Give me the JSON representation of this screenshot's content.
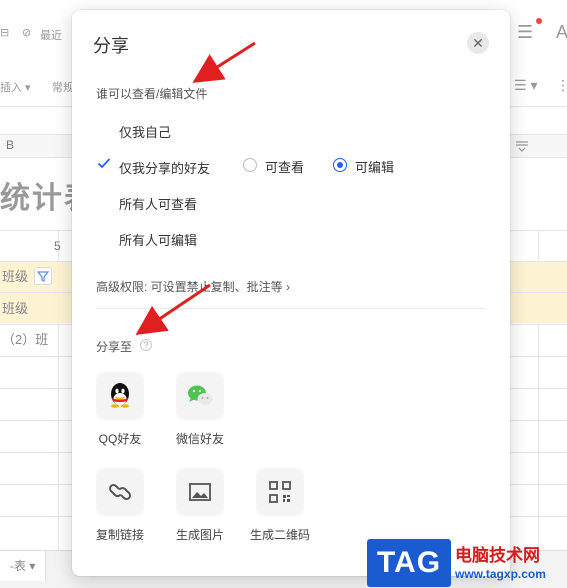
{
  "background": {
    "toolbar": {
      "recent_label": "最近",
      "insert_label": "插入",
      "normal_label": "常规",
      "top_right_letter": "A"
    },
    "column_header_label": "B",
    "sheet_title": "统计表",
    "column_number": "5",
    "cells": [
      "班级",
      "班级",
      "（2）班"
    ],
    "sheet_tab": "-表"
  },
  "dialog": {
    "title": "分享",
    "who_label": "谁可以查看/编辑文件",
    "options": [
      "仅我自己",
      "仅我分享的好友",
      "所有人可查看",
      "所有人可编辑"
    ],
    "radios": [
      "可查看",
      "可编辑"
    ],
    "selected_radio": "可编辑",
    "advanced": "高级权限: 可设置禁止复制、批注等",
    "share_to_label": "分享至",
    "targets": [
      {
        "label": "QQ好友",
        "icon": "qq-icon"
      },
      {
        "label": "微信好友",
        "icon": "wechat-icon"
      },
      {
        "label": "复制链接",
        "icon": "link-icon"
      },
      {
        "label": "生成图片",
        "icon": "image-icon"
      },
      {
        "label": "生成二维码",
        "icon": "qrcode-icon"
      }
    ]
  },
  "watermark": {
    "tag": "TAG",
    "name": "电脑技术网",
    "url": "www.tagxp.com"
  },
  "colors": {
    "accent": "#2060ff",
    "arrow": "#e02020",
    "highlight_row": "#fdf3d3",
    "watermark_blue": "#1a5bd0",
    "watermark_red": "#d61c1c"
  }
}
